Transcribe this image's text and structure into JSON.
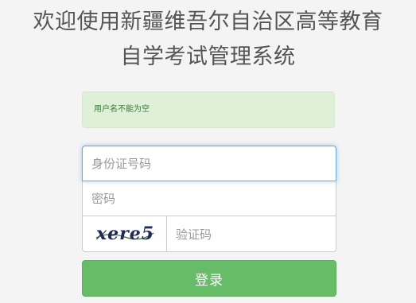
{
  "header": {
    "title_line1": "欢迎使用新疆维吾尔自治区高等教育",
    "title_line2": "自学考试管理系统"
  },
  "alert": {
    "message": "用户名不能为空"
  },
  "form": {
    "id_number": {
      "value": "",
      "placeholder": "身份证号码"
    },
    "password": {
      "value": "",
      "placeholder": "密码"
    },
    "captcha": {
      "image_text": "xere5",
      "value": "",
      "placeholder": "验证码"
    },
    "submit_label": "登录"
  },
  "colors": {
    "alert_bg": "#dff0d8",
    "alert_text": "#3c763d",
    "focus_border": "#66afe9",
    "button_bg": "#5cb85c",
    "captcha_text": "#1f2a5c"
  }
}
